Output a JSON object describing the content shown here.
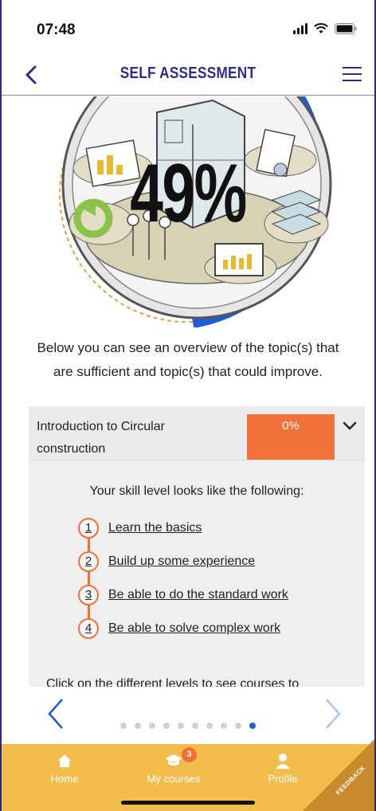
{
  "status_bar": {
    "time": "07:48"
  },
  "header": {
    "title": "SELF ASSESSMENT"
  },
  "hero": {
    "percent": "49%"
  },
  "intro_text": "Below you can see an overview of the topic(s) that are sufficient and topic(s) that could improve.",
  "topic_card": {
    "topic": "Introduction to Circular construction",
    "score": "0%",
    "skill_title": "Your skill level looks like the following:",
    "levels": [
      {
        "num": "1",
        "label": "Learn the basics"
      },
      {
        "num": "2",
        "label": "Build up some experience"
      },
      {
        "num": "3",
        "label": "Be able to do the standard work"
      },
      {
        "num": "4",
        "label": "Be able to solve complex work"
      }
    ],
    "cutoff_text": "Click on the different levels to see courses to"
  },
  "pager": {
    "total": 10,
    "active": 10
  },
  "nav": {
    "home": "Home",
    "courses": "My courses",
    "courses_badge": "3",
    "profile": "Profile",
    "feedback": "FEEDBACK"
  },
  "colors": {
    "accent": "#2d2d8f",
    "orange": "#f07038",
    "nav": "#f2bd4a",
    "blue": "#1f5bd8"
  }
}
